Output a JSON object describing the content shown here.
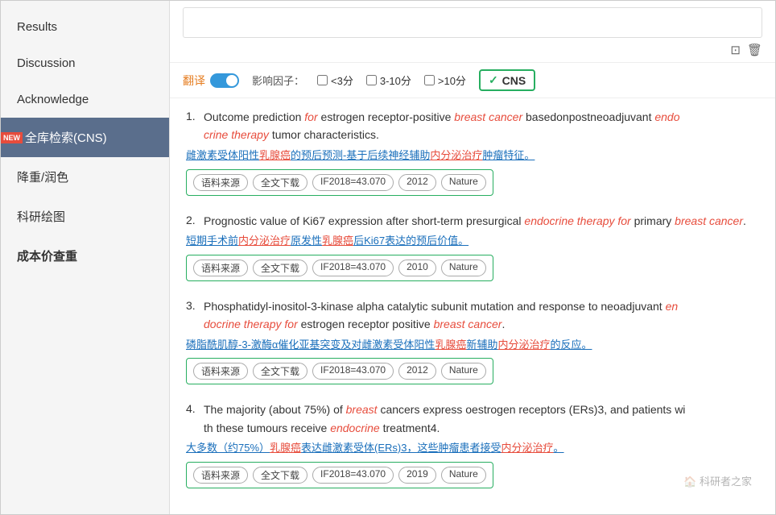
{
  "sidebar": {
    "items": [
      {
        "id": "results",
        "label": "Results",
        "active": false,
        "new": false
      },
      {
        "id": "discussion",
        "label": "Discussion",
        "active": false,
        "new": false
      },
      {
        "id": "acknowledge",
        "label": "Acknowledge",
        "active": false,
        "new": false
      },
      {
        "id": "cns-search",
        "label": "全库检索(CNS)",
        "active": true,
        "new": true
      },
      {
        "id": "reduce-color",
        "label": "降重/润色",
        "active": false,
        "new": false
      },
      {
        "id": "research-drawing",
        "label": "科研绘图",
        "active": false,
        "new": false
      },
      {
        "id": "cost-check",
        "label": "成本价查重",
        "active": false,
        "new": false
      }
    ]
  },
  "toolbar": {
    "search_placeholder": "",
    "copy_icon": "⊡",
    "delete_icon": "🗑"
  },
  "filter": {
    "translate_label": "翻译",
    "impact_label": "影响因子：",
    "options": [
      {
        "id": "lt3",
        "label": "<3分"
      },
      {
        "id": "3to10",
        "label": "3-10分"
      },
      {
        "id": "gt10",
        "label": ">10分"
      }
    ],
    "cns_label": "CNS",
    "cns_checked": true
  },
  "results": [
    {
      "num": "1",
      "title_parts": [
        {
          "text": "Outcome prediction ",
          "style": "normal"
        },
        {
          "text": "for",
          "style": "italic-red"
        },
        {
          "text": " estrogen receptor-positive ",
          "style": "normal"
        },
        {
          "text": "breast cancer",
          "style": "italic-red"
        },
        {
          "text": " basedonpostneoadjuvant ",
          "style": "normal"
        },
        {
          "text": "endo crine therapy",
          "style": "italic-red"
        },
        {
          "text": " tumor characteristics.",
          "style": "normal"
        }
      ],
      "title_en": "Outcome prediction for estrogen receptor-positive breast cancer basedonpostneoadjuvant endocrine therapy tumor characteristics.",
      "title_cn": "雌激素受体阳性乳腺癌的预后预测-基于后续神经辅助内分泌治疗肿瘤特征。",
      "if": "IF2018=43.070",
      "year": "2012",
      "journal": "Nature",
      "tags": [
        "语料来源",
        "全文下载",
        "IF2018=43.070",
        "2012",
        "Nature"
      ]
    },
    {
      "num": "2",
      "title_en": "Prognostic value of Ki67 expression after short-term presurgical endocrine therapy for primary breast cancer.",
      "title_cn": "短期手术前内分泌治疗原发性乳腺癌后Ki67表达的预后价值。",
      "if": "IF2018=43.070",
      "year": "2010",
      "journal": "Nature",
      "tags": [
        "语料来源",
        "全文下载",
        "IF2018=43.070",
        "2010",
        "Nature"
      ]
    },
    {
      "num": "3",
      "title_en": "Phosphatidyl-inositol-3-kinase alpha catalytic subunit mutation and response to neoadjuvant endocrine therapy for estrogen receptor positive breast cancer.",
      "title_cn": "磷脂酰肌醇-3-激酶α催化亚基突变及对雌激素受体阳性乳腺癌新辅助内分泌治疗的反应。",
      "if": "IF2018=43.070",
      "year": "2012",
      "journal": "Nature",
      "tags": [
        "语料来源",
        "全文下载",
        "IF2018=43.070",
        "2012",
        "Nature"
      ]
    },
    {
      "num": "4",
      "title_en": "The majority (about 75%) of breast cancers express oestrogen receptors (ERs)3, and patients with these tumours receive endocrine treatment4.",
      "title_cn": "大多数（约75%）乳腺癌表达雌激素受体(ERs)3，这些肿瘤患者接受内分泌治疗。",
      "if": "IF2018=43.070",
      "year": "2019",
      "journal": "Nature",
      "tags": [
        "语料来源",
        "全文下载",
        "IF2018=43.070",
        "2019",
        "Nature"
      ]
    }
  ],
  "watermark": "科研者之家"
}
